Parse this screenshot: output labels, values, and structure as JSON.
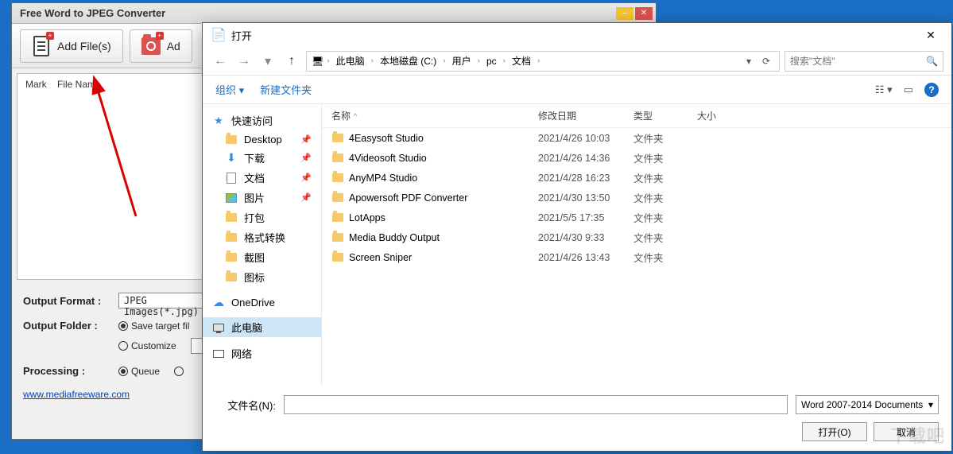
{
  "app": {
    "title": "Free Word to JPEG Converter",
    "toolbar": {
      "add_files": "Add File(s)",
      "add_folder": "Ad"
    },
    "list_header": {
      "mark": "Mark",
      "filename": "File Name"
    },
    "options": {
      "output_format_label": "Output Format :",
      "output_format_value": "JPEG Images(*.jpg)",
      "output_folder_label": "Output Folder :",
      "radio_save_target": "Save target fil",
      "radio_customize": "Customize",
      "processing_label": "Processing :",
      "radio_queue": "Queue"
    },
    "link": "www.mediafreeware.com"
  },
  "dialog": {
    "title": "打开",
    "breadcrumb": [
      "此电脑",
      "本地磁盘 (C:)",
      "用户",
      "pc",
      "文档"
    ],
    "search_placeholder": "搜索\"文档\"",
    "cmd": {
      "organize": "组织",
      "new_folder": "新建文件夹"
    },
    "columns": {
      "name": "名称",
      "date": "修改日期",
      "type": "类型",
      "size": "大小"
    },
    "sidebar": {
      "quick": "快速访问",
      "desktop": "Desktop",
      "downloads": "下载",
      "documents": "文档",
      "pictures": "图片",
      "dabao": "打包",
      "geshi": "格式转换",
      "jietu": "截图",
      "tubiao": "图标",
      "onedrive": "OneDrive",
      "thispc": "此电脑",
      "network": "网络"
    },
    "files": [
      {
        "name": "4Easysoft Studio",
        "date": "2021/4/26 10:03",
        "type": "文件夹"
      },
      {
        "name": "4Videosoft Studio",
        "date": "2021/4/26 14:36",
        "type": "文件夹"
      },
      {
        "name": "AnyMP4 Studio",
        "date": "2021/4/28 16:23",
        "type": "文件夹"
      },
      {
        "name": "Apowersoft PDF Converter",
        "date": "2021/4/30 13:50",
        "type": "文件夹"
      },
      {
        "name": "LotApps",
        "date": "2021/5/5 17:35",
        "type": "文件夹"
      },
      {
        "name": "Media Buddy Output",
        "date": "2021/4/30 9:33",
        "type": "文件夹"
      },
      {
        "name": "Screen Sniper",
        "date": "2021/4/26 13:43",
        "type": "文件夹"
      }
    ],
    "filename_label": "文件名(N):",
    "filter": "Word 2007-2014 Documents",
    "open_btn": "打开(O)",
    "cancel_btn": "取消"
  },
  "watermark": "下载吧"
}
